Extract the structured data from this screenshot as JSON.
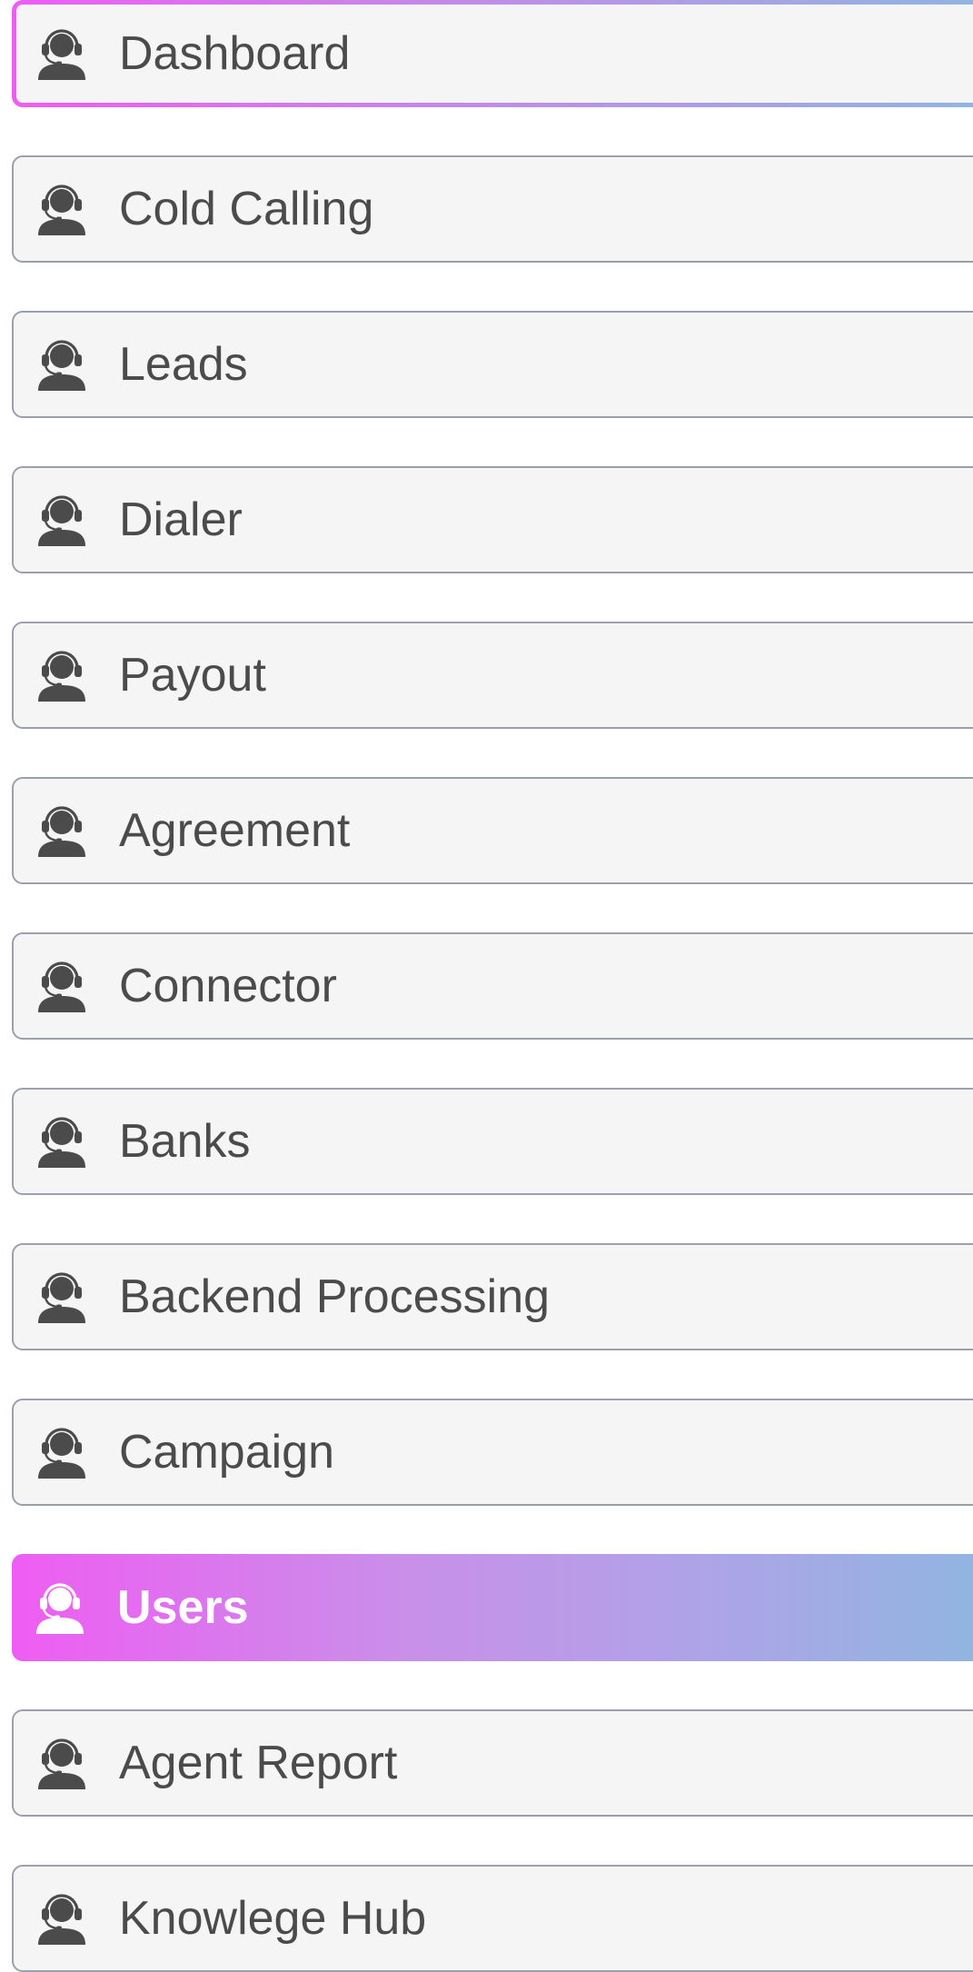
{
  "sidebar": {
    "items": [
      {
        "label": "Dashboard",
        "icon": "headset-agent-icon",
        "state": "focused"
      },
      {
        "label": "Cold Calling",
        "icon": "headset-agent-icon",
        "state": "default"
      },
      {
        "label": "Leads",
        "icon": "headset-agent-icon",
        "state": "default"
      },
      {
        "label": "Dialer",
        "icon": "headset-agent-icon",
        "state": "default"
      },
      {
        "label": "Payout",
        "icon": "headset-agent-icon",
        "state": "default"
      },
      {
        "label": "Agreement",
        "icon": "headset-agent-icon",
        "state": "default"
      },
      {
        "label": "Connector",
        "icon": "headset-agent-icon",
        "state": "default"
      },
      {
        "label": "Banks",
        "icon": "headset-agent-icon",
        "state": "default"
      },
      {
        "label": "Backend Processing",
        "icon": "headset-agent-icon",
        "state": "default"
      },
      {
        "label": "Campaign",
        "icon": "headset-agent-icon",
        "state": "default"
      },
      {
        "label": "Users",
        "icon": "headset-agent-icon",
        "state": "active"
      },
      {
        "label": "Agent Report",
        "icon": "headset-agent-icon",
        "state": "default"
      },
      {
        "label": "Knowlege Hub",
        "icon": "headset-agent-icon",
        "state": "default"
      }
    ]
  },
  "colors": {
    "gradient_start": "#ee5df2",
    "gradient_end": "#8fb6e0",
    "item_background": "#f5f5f5",
    "item_border": "#9aa1ab",
    "label_text": "#4b4b4b",
    "active_text": "#ffffff"
  }
}
